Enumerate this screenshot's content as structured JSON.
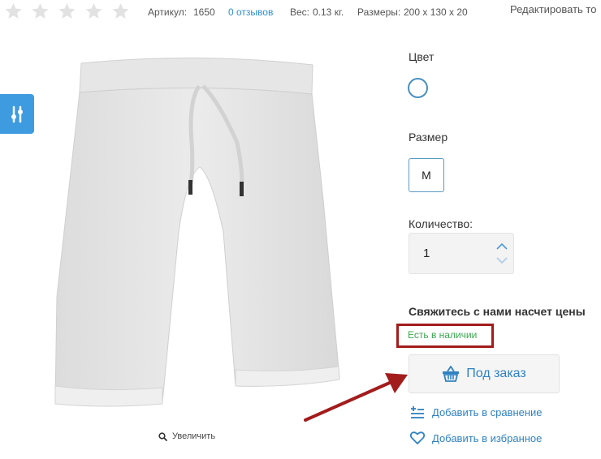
{
  "rating": {
    "stars": 5,
    "filled": 0
  },
  "product_info": {
    "sku_label": "Артикул:",
    "sku_value": "1650",
    "reviews": "0 отзывов",
    "weight_label": "Вес:",
    "weight_value": "0.13 кг.",
    "size_label": "Размеры:",
    "size_value": "200 х 130 х 20"
  },
  "edit_link": "Редактировать то",
  "zoom_label": "Увеличить",
  "options": {
    "color_label": "Цвет",
    "size_label": "Размер",
    "size_selected": "M",
    "qty_label": "Количество:",
    "qty_value": "1"
  },
  "price_contact": "Свяжитесь с нами насчет цены",
  "stock_status": "Есть в наличии",
  "order_button": "Под заказ",
  "compare_link": "Добавить в сравнение",
  "favorite_link": "Добавить в избранное",
  "colors": {
    "accent": "#2f82c2",
    "filter_button": "#3e9be0",
    "in_stock": "#3aa84f",
    "annotation": "#a31c1c"
  }
}
